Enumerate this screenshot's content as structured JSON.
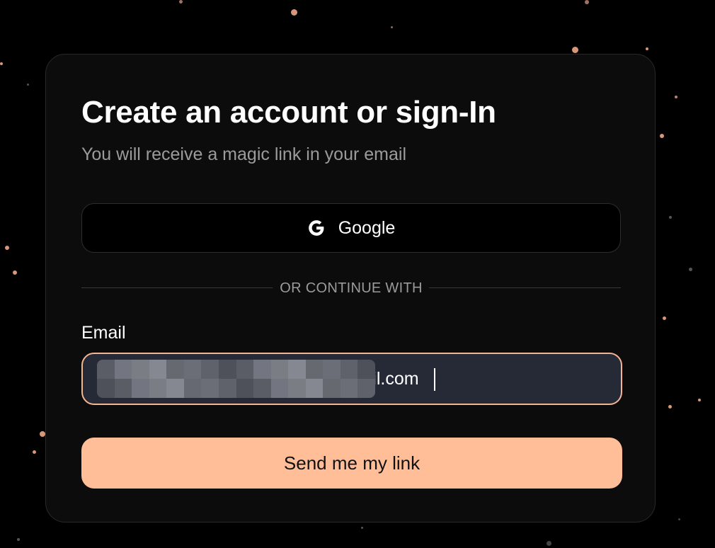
{
  "page": {
    "background_color": "#000000",
    "accent_color": "#ffbe98",
    "particle_color": "#d9977a"
  },
  "card": {
    "title": "Create an account or sign-In",
    "subtitle": "You will receive a magic link in your email",
    "google_button": {
      "label": "Google",
      "icon": "google-g-icon"
    },
    "divider_text": "OR CONTINUE WITH",
    "email": {
      "label": "Email",
      "visible_value_suffix": "il.com",
      "redacted": true
    },
    "submit_label": "Send me my link"
  }
}
